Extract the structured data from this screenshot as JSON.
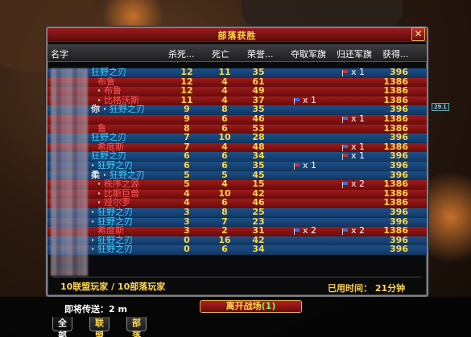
{
  "window": {
    "title": "部落获胜",
    "close_label": "✕"
  },
  "columns": [
    "名字",
    "杀死...",
    "死亡",
    "荣誉...",
    "夺取军旗",
    "归还军旗",
    "获得..."
  ],
  "rows": [
    {
      "faction": "alliance",
      "name": "狂野之刃",
      "sep": "",
      "kb": "12",
      "deaths": "11",
      "honor": "35",
      "cap": "",
      "ret": "x 1",
      "reward": "396"
    },
    {
      "faction": "horde",
      "name": "布鲁",
      "sep": "",
      "kb": "12",
      "deaths": "4",
      "honor": "61",
      "cap": "",
      "ret": "",
      "reward": "1386"
    },
    {
      "faction": "horde",
      "name": "布鲁",
      "sep": "· ",
      "kb": "12",
      "deaths": "4",
      "honor": "49",
      "cap": "",
      "ret": "",
      "reward": "1386"
    },
    {
      "faction": "horde",
      "name": "比格沃斯",
      "sep": "· ",
      "kb": "11",
      "deaths": "4",
      "honor": "37",
      "cap": "x 1",
      "ret": "",
      "reward": "1386"
    },
    {
      "faction": "alliance",
      "name": "狂野之刃",
      "sep": "你 · ",
      "kb": "9",
      "deaths": "8",
      "honor": "35",
      "cap": "",
      "ret": "",
      "reward": "396"
    },
    {
      "faction": "horde",
      "name": "",
      "sep": "",
      "kb": "9",
      "deaths": "6",
      "honor": "46",
      "cap": "",
      "ret": "x 1",
      "reward": "1386"
    },
    {
      "faction": "horde",
      "name": "鲁",
      "sep": "",
      "kb": "8",
      "deaths": "6",
      "honor": "53",
      "cap": "",
      "ret": "",
      "reward": "1386"
    },
    {
      "faction": "alliance",
      "name": "狂野之刃",
      "sep": "",
      "kb": "7",
      "deaths": "10",
      "honor": "28",
      "cap": "",
      "ret": "",
      "reward": "396"
    },
    {
      "faction": "horde",
      "name": "希度斯",
      "sep": "",
      "kb": "7",
      "deaths": "4",
      "honor": "48",
      "cap": "",
      "ret": "x 1",
      "reward": "1386"
    },
    {
      "faction": "alliance",
      "name": "狂野之刃",
      "sep": "",
      "kb": "6",
      "deaths": "6",
      "honor": "34",
      "cap": "",
      "ret": "x 1",
      "reward": "396"
    },
    {
      "faction": "alliance",
      "name": "狂野之刃",
      "sep": "· ",
      "kb": "6",
      "deaths": "6",
      "honor": "35",
      "cap": "x 1",
      "ret": "",
      "reward": "396"
    },
    {
      "faction": "alliance",
      "name": "狂野之刃",
      "sep": "柔 · ",
      "kb": "5",
      "deaths": "5",
      "honor": "45",
      "cap": "",
      "ret": "",
      "reward": "396"
    },
    {
      "faction": "horde",
      "name": "秩序之源",
      "sep": "· ",
      "kb": "5",
      "deaths": "4",
      "honor": "15",
      "cap": "",
      "ret": "x 2",
      "reward": "1386"
    },
    {
      "faction": "horde",
      "name": "比斯巨兽",
      "sep": "· ",
      "kb": "4",
      "deaths": "10",
      "honor": "42",
      "cap": "",
      "ret": "",
      "reward": "1386"
    },
    {
      "faction": "horde",
      "name": "娅尔罗",
      "sep": "· ",
      "kb": "4",
      "deaths": "6",
      "honor": "46",
      "cap": "",
      "ret": "",
      "reward": "1386"
    },
    {
      "faction": "alliance",
      "name": "狂野之刃",
      "sep": "· ",
      "kb": "3",
      "deaths": "8",
      "honor": "25",
      "cap": "",
      "ret": "",
      "reward": "396"
    },
    {
      "faction": "alliance",
      "name": "狂野之刃",
      "sep": "· ",
      "kb": "3",
      "deaths": "7",
      "honor": "23",
      "cap": "",
      "ret": "",
      "reward": "396"
    },
    {
      "faction": "horde",
      "name": "希度斯",
      "sep": "",
      "kb": "3",
      "deaths": "2",
      "honor": "31",
      "cap": "x 2",
      "ret": "x 2",
      "reward": "1386"
    },
    {
      "faction": "alliance",
      "name": "狂野之刃",
      "sep": "· ",
      "kb": "0",
      "deaths": "16",
      "honor": "42",
      "cap": "",
      "ret": "",
      "reward": "396"
    },
    {
      "faction": "alliance",
      "name": "狂野之刃",
      "sep": "· ",
      "kb": "0",
      "deaths": "6",
      "honor": "34",
      "cap": "",
      "ret": "",
      "reward": "396"
    }
  ],
  "summary": {
    "players": "10联盟玩家 / 10部落玩家",
    "time": "已用时间： 21分钟"
  },
  "transfer": "即将传送：2 m",
  "leave_button": {
    "label": "离开战场",
    "count": "(1)"
  },
  "tabs": [
    "全部",
    "联盟",
    "部落"
  ],
  "side_badge": "29.1",
  "colors": {
    "alliance_row": "#1d4f86",
    "horde_row": "#a01a1a",
    "gold_text": "#ffd84a",
    "alliance_name": "#3bd1ff",
    "horde_name": "#ff5858"
  }
}
